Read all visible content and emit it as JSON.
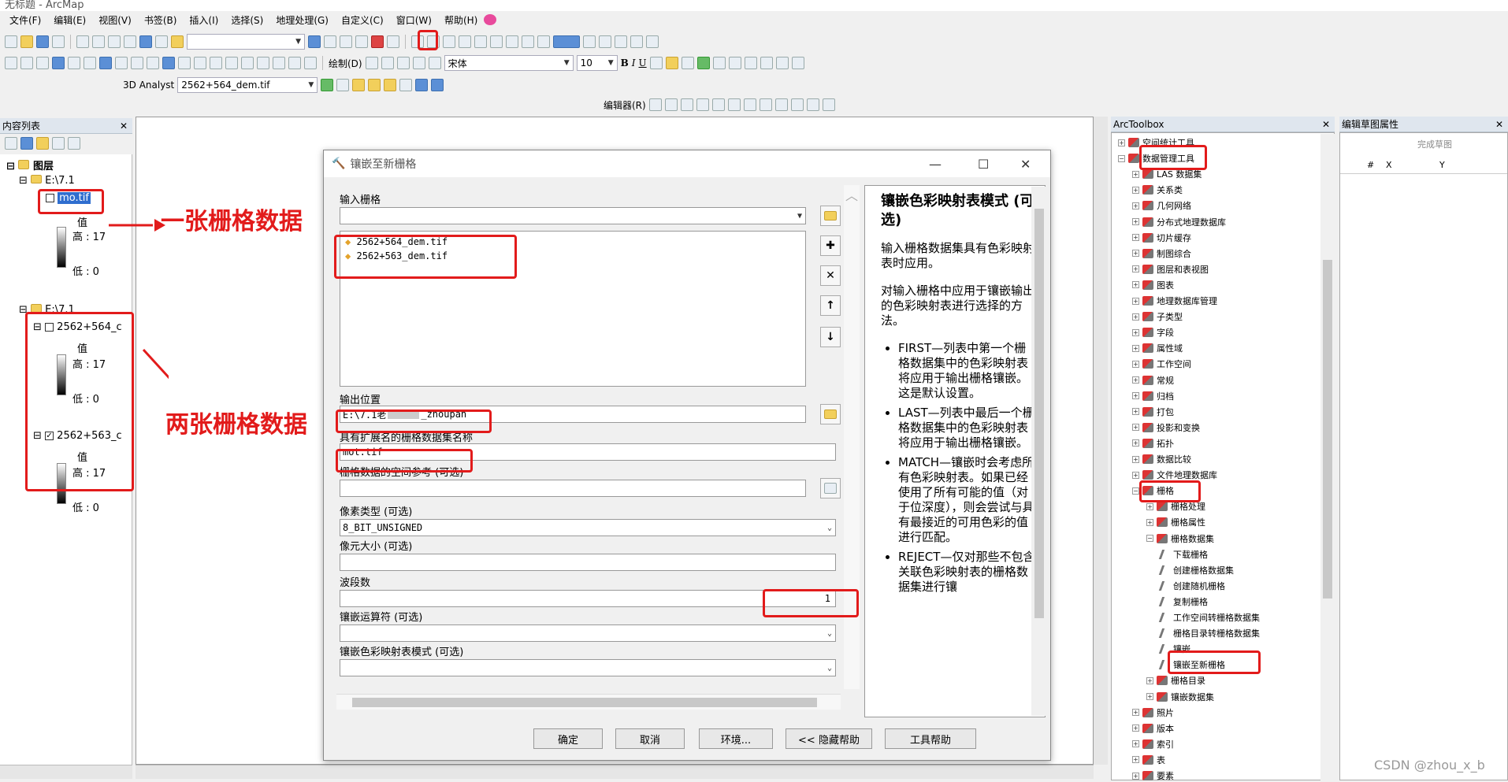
{
  "app": {
    "title": "无标题 - ArcMap"
  },
  "menu": [
    "文件(F)",
    "编辑(E)",
    "视图(V)",
    "书签(B)",
    "插入(I)",
    "选择(S)",
    "地理处理(G)",
    "自定义(C)",
    "窗口(W)",
    "帮助(H)"
  ],
  "toolbar": {
    "font_name": "宋体",
    "font_size": "10",
    "draw_label": "绘制(D)",
    "analyst_label": "3D Analyst",
    "layer_combo": "2562+564_dem.tif",
    "editor_label": "编辑器(R)"
  },
  "toc": {
    "title": "内容列表",
    "root": "图层",
    "group1": "E:\\7.1",
    "layer1": "mo.tif",
    "layer1_value": "值",
    "layer1_high": "高 : 17",
    "layer1_low": "低 : 0",
    "group2": "E:\\7.1",
    "layer2": "2562+564_c",
    "layer2_value": "值",
    "layer2_high": "高 : 17",
    "layer2_low": "低 : 0",
    "layer3": "2562+563_c",
    "layer3_value": "值",
    "layer3_high": "高 : 17",
    "layer3_low": "低 : 0"
  },
  "annotations": {
    "one": "一张栅格数据",
    "two": "两张栅格数据"
  },
  "dialog": {
    "title": "镶嵌至新栅格",
    "input_label": "输入栅格",
    "inputs": [
      "2562+564_dem.tif",
      "2562+563_dem.tif"
    ],
    "out_loc_label": "输出位置",
    "out_loc_value": "E:\\7.1老",
    "out_loc_suffix": "_zhoupan",
    "name_label": "具有扩展名的栅格数据集名称",
    "name_value": "mot.tif",
    "sr_label": "栅格数据的空间参考 (可选)",
    "pixel_label": "像素类型 (可选)",
    "pixel_value": "8_BIT_UNSIGNED",
    "cellsize_label": "像元大小 (可选)",
    "bands_label": "波段数",
    "bands_value": "1",
    "operator_label": "镶嵌运算符 (可选)",
    "colormap_label": "镶嵌色彩映射表模式 (可选)",
    "buttons": {
      "ok": "确定",
      "cancel": "取消",
      "env": "环境...",
      "hide": "<< 隐藏帮助",
      "help": "工具帮助"
    }
  },
  "help": {
    "title": "镶嵌色彩映射表模式 (可选)",
    "p1": "输入栅格数据集具有色彩映射表时应用。",
    "p2": "对输入栅格中应用于镶嵌输出的色彩映射表进行选择的方法。",
    "items": [
      "FIRST—列表中第一个栅格数据集中的色彩映射表将应用于输出栅格镶嵌。这是默认设置。",
      "LAST—列表中最后一个栅格数据集中的色彩映射表将应用于输出栅格镶嵌。",
      "MATCH—镶嵌时会考虑所有色彩映射表。如果已经使用了所有可能的值（对于位深度），则会尝试与具有最接近的可用色彩的值进行匹配。",
      "REJECT—仅对那些不包含关联色彩映射表的栅格数据集进行镶"
    ]
  },
  "arctoolbox": {
    "title": "ArcToolbox",
    "items": [
      "空间统计工具",
      "数据管理工具",
      "LAS 数据集",
      "关系类",
      "几何网络",
      "分布式地理数据库",
      "切片缓存",
      "制图综合",
      "图层和表视图",
      "图表",
      "地理数据库管理",
      "子类型",
      "字段",
      "属性域",
      "工作空间",
      "常规",
      "归档",
      "打包",
      "投影和变换",
      "拓扑",
      "数据比较",
      "文件地理数据库",
      "栅格",
      "栅格处理",
      "栅格属性",
      "栅格数据集",
      "下载栅格",
      "创建栅格数据集",
      "创建随机栅格",
      "复制栅格",
      "工作空间转栅格数据集",
      "栅格目录转栅格数据集",
      "镶嵌",
      "镶嵌至新栅格",
      "栅格目录",
      "镶嵌数据集",
      "照片",
      "版本",
      "索引",
      "表",
      "要素"
    ]
  },
  "edit_panel": {
    "title": "编辑草图属性",
    "finish": "完成草图",
    "cols": [
      "#",
      "X",
      "Y"
    ]
  },
  "watermark": "CSDN @zhou_x_b"
}
